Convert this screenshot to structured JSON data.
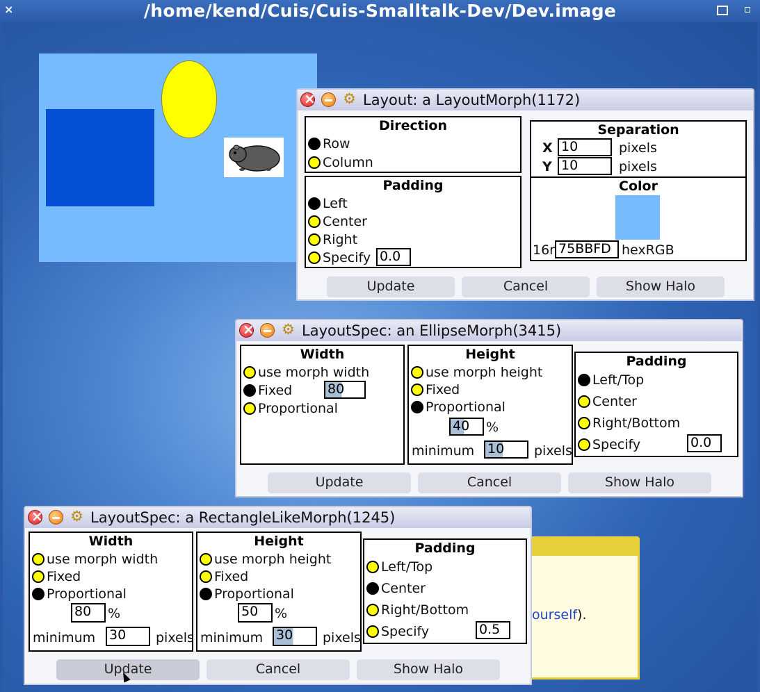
{
  "window": {
    "title": "/home/kend/Cuis/Cuis-Smalltalk-Dev/Dev.image",
    "close_glyph": "×"
  },
  "layout_win": {
    "title": "Layout: a LayoutMorph(1172)",
    "direction": {
      "header": "Direction",
      "options": [
        "Row",
        "Column"
      ],
      "selected": "Row"
    },
    "separation": {
      "header": "Separation",
      "x_label": "X",
      "x_value": "10",
      "y_label": "Y",
      "y_value": "10",
      "unit": "pixels"
    },
    "padding": {
      "header": "Padding",
      "options": [
        "Left",
        "Center",
        "Right",
        "Specify"
      ],
      "selected": "Left",
      "specify_value": "0.0"
    },
    "color": {
      "header": "Color",
      "prefix": "16r",
      "hex_value": "75BBFD",
      "suffix": "hexRGB",
      "swatch": "#75bbfd"
    },
    "buttons": {
      "update": "Update",
      "cancel": "Cancel",
      "show_halo": "Show Halo"
    }
  },
  "ellipse_win": {
    "title": "LayoutSpec: an EllipseMorph(3415)",
    "width": {
      "header": "Width",
      "opt_use": "use morph width",
      "opt_fixed": "Fixed",
      "opt_prop": "Proportional",
      "selected": "Fixed",
      "fixed_value": "80"
    },
    "height": {
      "header": "Height",
      "opt_use": "use morph height",
      "opt_fixed": "Fixed",
      "opt_prop": "Proportional",
      "selected": "Proportional",
      "percent_value": "40",
      "percent_sign": "%",
      "minimum_label": "minimum",
      "minimum_value": "10",
      "unit": "pixels"
    },
    "padding": {
      "header": "Padding",
      "opt_lefttop": "Left/Top",
      "opt_center": "Center",
      "opt_rightbottom": "Right/Bottom",
      "opt_specify": "Specify",
      "selected": "Left/Top",
      "specify_value": "0.0"
    },
    "buttons": {
      "update": "Update",
      "cancel": "Cancel",
      "show_halo": "Show Halo"
    }
  },
  "rect_win": {
    "title": "LayoutSpec: a RectangleLikeMorph(1245)",
    "width": {
      "header": "Width",
      "opt_use": "use morph width",
      "opt_fixed": "Fixed",
      "opt_prop": "Proportional",
      "selected": "Proportional",
      "percent_value": "80",
      "percent_sign": "%",
      "minimum_label": "minimum",
      "minimum_value": "30",
      "unit": "pixels"
    },
    "height": {
      "header": "Height",
      "opt_use": "use morph height",
      "opt_fixed": "Fixed",
      "opt_prop": "Proportional",
      "selected": "Proportional",
      "percent_value": "50",
      "percent_sign": "%",
      "minimum_label": "minimum",
      "minimum_value": "30",
      "unit": "pixels"
    },
    "padding": {
      "header": "Padding",
      "opt_lefttop": "Left/Top",
      "opt_center": "Center",
      "opt_rightbottom": "Right/Bottom",
      "opt_specify": "Specify",
      "selected": "Center",
      "specify_value": "0.5"
    },
    "buttons": {
      "update": "Update",
      "cancel": "Cancel",
      "show_halo": "Show Halo"
    }
  },
  "background_text": {
    "link": "ourself",
    "tail": ")."
  },
  "colors": {
    "canvas": "#75bbfd",
    "rectangle": "#0650d6",
    "ellipse": "#ffff00"
  }
}
